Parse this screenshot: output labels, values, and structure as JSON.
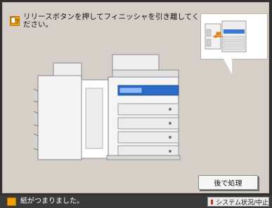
{
  "message": {
    "text": "リリースボタンを押してフィニッシャを引き離してください。",
    "icon": "paper-jam-icon"
  },
  "actions": {
    "later_label": "後で処理"
  },
  "status": {
    "icon": "paper-jam-icon",
    "text": "紙がつまりました。",
    "system_button_label": "システム状況/中止",
    "system_indicator_color": "#d5281c"
  },
  "colors": {
    "panel_bg": "#d6cfc8",
    "status_bar_bg": "#3b3b3b",
    "warning": "#f0a000",
    "accent": "#2a6cc7"
  }
}
